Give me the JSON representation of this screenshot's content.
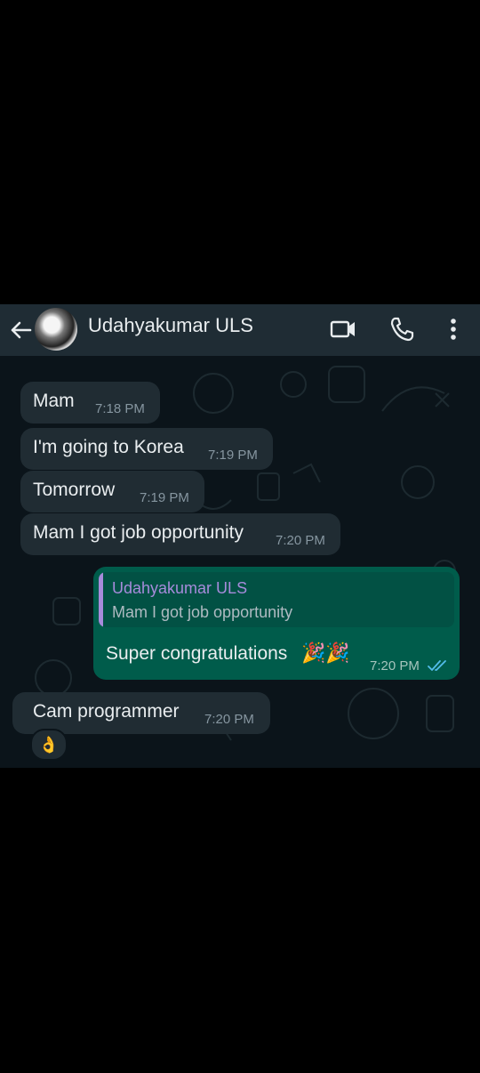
{
  "header": {
    "contact_name": "Udahyakumar ULS",
    "icons": [
      "back-arrow-icon",
      "video-call-icon",
      "phone-icon",
      "more-options-icon"
    ]
  },
  "messages": [
    {
      "text": "Mam",
      "time": "7:18 PM",
      "direction": "incoming"
    },
    {
      "text": "I'm going to Korea",
      "time": "7:19 PM",
      "direction": "incoming"
    },
    {
      "text": "Tomorrow",
      "time": "7:19 PM",
      "direction": "incoming"
    },
    {
      "text": "Mam I got job opportunity",
      "time": "7:20 PM",
      "direction": "incoming"
    },
    {
      "quoted_name": "Udahyakumar ULS",
      "quoted_text": "Mam I got job opportunity",
      "text": "Super congratulations",
      "emoji": "🎉🎉",
      "time": "7:20 PM",
      "direction": "outgoing",
      "status": "read"
    },
    {
      "text": "Cam programmer",
      "time": "7:20 PM",
      "direction": "incoming",
      "reaction": "👌"
    }
  ],
  "colors": {
    "header_bg": "#1f2c34",
    "chat_bg": "#0b141a",
    "incoming_bubble": "#202c33",
    "outgoing_bubble": "#005c4b",
    "read_ticks": "#53bdeb",
    "quote_accent": "#a78bdb"
  }
}
